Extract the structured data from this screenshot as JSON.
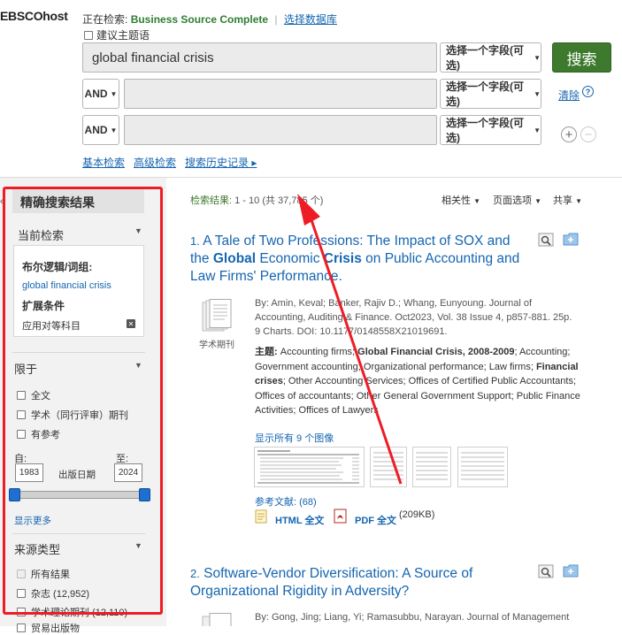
{
  "header": {
    "logo": "EBSCOhost",
    "searching_label": "正在检索:",
    "database": "Business Source Complete",
    "choose_databases": "选择数据库",
    "suggest_subject": "建议主题语"
  },
  "search": {
    "rows": [
      {
        "operator": "",
        "query": "global financial crisis",
        "field": "选择一个字段(可选)"
      },
      {
        "operator": "AND",
        "query": "",
        "field": "选择一个字段(可选)"
      },
      {
        "operator": "AND",
        "query": "",
        "field": "选择一个字段(可选)"
      }
    ],
    "search_button": "搜索",
    "clear": "清除",
    "help": "?",
    "add_row": "+",
    "remove_row": "−",
    "links": [
      "基本检索",
      "高级检索",
      "搜索历史记录 ▸"
    ]
  },
  "refine": {
    "title": "精确搜索结果",
    "collapse_arrow": "«",
    "current_search": {
      "heading": "当前检索",
      "boolean_label": "布尔逻辑/词组:",
      "boolean_value": "global financial crisis",
      "expanders_label": "扩展条件",
      "expander_value": "应用对等科目",
      "remove": "✕"
    },
    "limit_to": {
      "heading": "限于",
      "options": [
        "全文",
        "学术（同行评审）期刊",
        "有参考"
      ],
      "from_label": "自:",
      "to_label": "至:",
      "from_year": "1983",
      "to_year": "2024",
      "date_label": "出版日期",
      "show_more": "显示更多"
    },
    "source_types": {
      "heading": "来源类型",
      "options": [
        "所有结果",
        "杂志 (12,952)",
        "学术理论期刊 (12,110)",
        "贸易出版物"
      ]
    }
  },
  "results": {
    "count_label": "检索结果:",
    "count_range": "1 - 10",
    "count_total": "(共 37,785 个)",
    "toolbar": {
      "relevance": "相关性",
      "page_options": "页面选项",
      "share": "共享"
    },
    "items": [
      {
        "number": "1.",
        "title_parts": [
          "A Tale of Two Professions: The Impact of SOX and the ",
          "Global",
          " Economic ",
          "Crisis",
          " on Public Accounting and Law Firms' Performance."
        ],
        "meta": "By: Amin, Keval; Banker, Rajiv D.; Whang, Eunyoung. Journal of Accounting, Auditing & Finance. Oct2023, Vol. 38 Issue 4, p857-881. 25p. 9 Charts. DOI: 10.1177/0148558X21019691.",
        "subject_label": "主题:",
        "subject_parts": [
          "Accounting firms; ",
          "Global Financial Crisis, 2008-2009",
          "; Accounting; Government accounting; Organizational performance; Law firms; ",
          "Financial crises",
          "; Other Accounting Services; Offices of Certified Public Accountants; Offices of accountants; Other General Government Support; Public Finance Activities; Offices of Lawyers"
        ],
        "doc_type": "学术期刊",
        "images_link": "显示所有 9 个图像",
        "references": "参考文献: (68)",
        "html_full_text": "HTML 全文",
        "pdf_full_text": "PDF 全文",
        "pdf_size": "(209KB)"
      },
      {
        "number": "2.",
        "title": "Software-Vendor Diversification: A Source of Organizational Rigidity in Adversity?",
        "meta": "By: Gong, Jing; Liang, Yi; Ramasubbu, Narayan. Journal of Management"
      }
    ]
  },
  "colors": {
    "link": "#1565b0",
    "green": "#3d7a2e",
    "annotation_red": "#ee1c25"
  }
}
